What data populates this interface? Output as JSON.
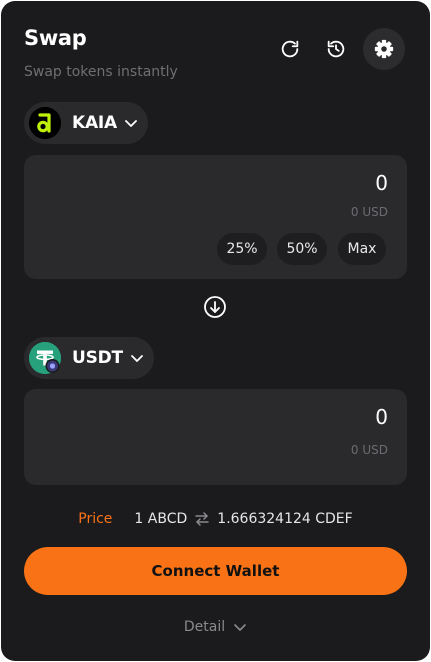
{
  "header": {
    "title": "Swap",
    "subtitle": "Swap tokens instantly",
    "buttons": [
      "refresh-icon",
      "history-icon",
      "gear-icon"
    ]
  },
  "from": {
    "token": "KAIA",
    "amount": "0",
    "usd": "0 USD",
    "percent_buttons": [
      "25%",
      "50%",
      "Max"
    ]
  },
  "to": {
    "token": "USDT",
    "amount": "0",
    "usd": "0 USD"
  },
  "price": {
    "label": "Price",
    "from": "1 ABCD",
    "to": "1.666324124 CDEF"
  },
  "connect_button": "Connect Wallet",
  "detail": {
    "label": "Detail"
  },
  "colors": {
    "accent": "#f97316",
    "card_background": "#1b1b1d",
    "panel_background": "#2a2a2d",
    "kaia_brand": "#bff009",
    "usdt_brand": "#26a17b"
  }
}
